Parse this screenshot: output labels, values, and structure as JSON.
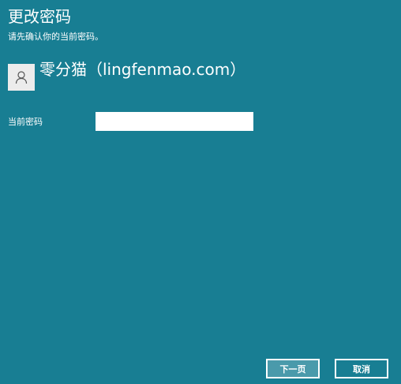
{
  "header": {
    "title": "更改密码",
    "subtitle": "请先确认你的当前密码。"
  },
  "user": {
    "avatar_icon": "user-icon",
    "name": "零分猫（lingfenmao.com）"
  },
  "form": {
    "current_password_label": "当前密码",
    "current_password_value": "",
    "current_password_placeholder": ""
  },
  "buttons": {
    "next_label": "下一页",
    "cancel_label": "取消"
  },
  "colors": {
    "background": "#187e93",
    "text": "#ffffff",
    "avatar_background": "#ececec",
    "input_background": "#ffffff"
  }
}
